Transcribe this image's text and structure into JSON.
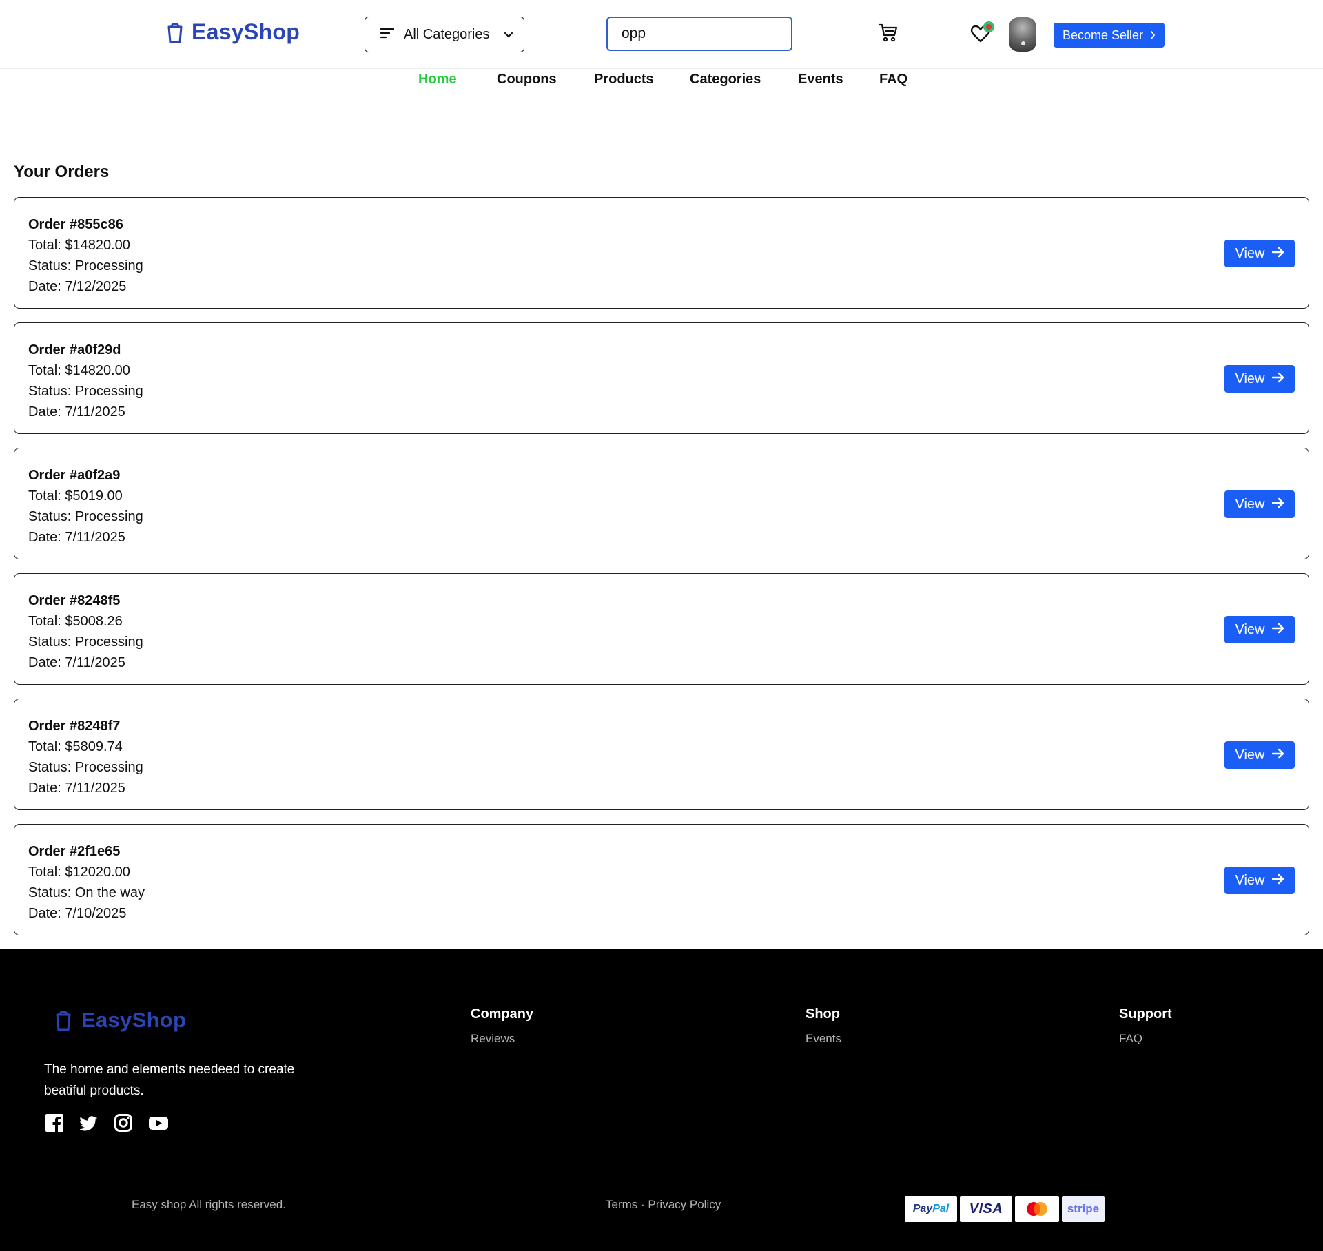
{
  "header": {
    "brand": "EasyShop",
    "categories_label": "All Categories",
    "search_value": "opp",
    "become_seller_label": "Become Seller"
  },
  "nav": {
    "items": [
      {
        "label": "Home",
        "active": true
      },
      {
        "label": "Coupons",
        "active": false
      },
      {
        "label": "Products",
        "active": false
      },
      {
        "label": "Categories",
        "active": false
      },
      {
        "label": "Events",
        "active": false
      },
      {
        "label": "FAQ",
        "active": false
      }
    ]
  },
  "orders": {
    "title": "Your Orders",
    "view_label": "View",
    "items": [
      {
        "id": "Order #855c86",
        "total": "Total: $14820.00",
        "status": "Status: Processing",
        "date": "Date: 7/12/2025"
      },
      {
        "id": "Order #a0f29d",
        "total": "Total: $14820.00",
        "status": "Status: Processing",
        "date": "Date: 7/11/2025"
      },
      {
        "id": "Order #a0f2a9",
        "total": "Total: $5019.00",
        "status": "Status: Processing",
        "date": "Date: 7/11/2025"
      },
      {
        "id": "Order #8248f5",
        "total": "Total: $5008.26",
        "status": "Status: Processing",
        "date": "Date: 7/11/2025"
      },
      {
        "id": "Order #8248f7",
        "total": "Total: $5809.74",
        "status": "Status: Processing",
        "date": "Date: 7/11/2025"
      },
      {
        "id": "Order #2f1e65",
        "total": "Total: $12020.00",
        "status": "Status: On the way",
        "date": "Date: 7/10/2025"
      }
    ]
  },
  "footer": {
    "brand": "EasyShop",
    "tagline": "The home and elements needeed to create beatiful products.",
    "columns": [
      {
        "title": "Company",
        "link": "Reviews"
      },
      {
        "title": "Shop",
        "link": "Events"
      },
      {
        "title": "Support",
        "link": "FAQ"
      }
    ],
    "copyright": "Easy shop All rights reserved.",
    "terms_label": "Terms",
    "separator": "·",
    "privacy_label": "Privacy Policy",
    "payments": {
      "paypal_part1": "Pay",
      "paypal_part2": "Pal",
      "visa": "VISA",
      "stripe": "stripe"
    }
  },
  "colors": {
    "brand": "#2b45b5",
    "primary_button": "#1a5ef5",
    "nav_active": "#27c93f",
    "search_border": "#2f5fd0",
    "footer_bg": "#000000"
  },
  "icons": [
    "shopping-bag-icon",
    "menu-lines-icon",
    "chevron-down-icon",
    "cart-icon",
    "heart-icon",
    "chevron-right-icon",
    "arrow-right-icon",
    "facebook-icon",
    "twitter-icon",
    "instagram-icon",
    "youtube-icon",
    "mastercard-icon"
  ]
}
